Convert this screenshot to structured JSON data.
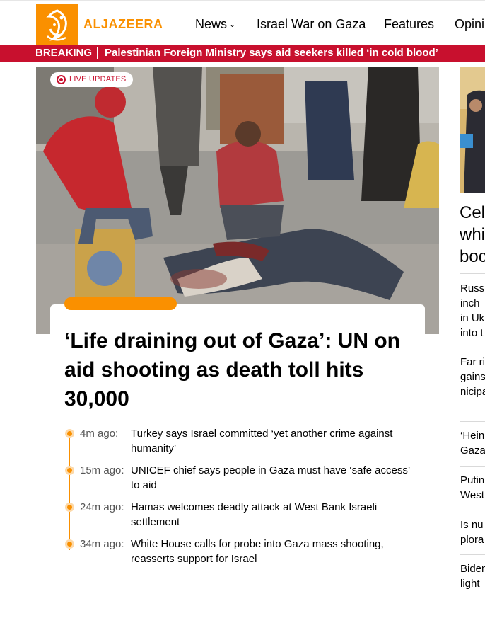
{
  "header": {
    "brand": "ALJAZEERA",
    "nav": [
      {
        "label": "News",
        "has_dropdown": true
      },
      {
        "label": "Israel War on Gaza"
      },
      {
        "label": "Features"
      },
      {
        "label": "Opini"
      }
    ],
    "icons": {
      "logo": "al-jazeera-logo-icon",
      "dropdown": "chevron-down-icon"
    }
  },
  "breaking": {
    "label": "BREAKING",
    "text": "Palestinian Foreign Ministry says aid seekers killed ‘in cold blood’"
  },
  "hero": {
    "badge": "LIVE UPDATES",
    "headline_lines": [
      "‘Life draining out of Gaza’: UN on",
      "aid shooting as death toll hits",
      "30,000"
    ]
  },
  "timeline": [
    {
      "time": "4m ago:",
      "text": "Turkey says Israel committed ‘yet another crime against humanity’"
    },
    {
      "time": "15m ago:",
      "text": "UNICEF chief says people in Gaza must have ‘safe access’ to aid"
    },
    {
      "time": "24m ago:",
      "text": "Hamas welcomes deadly attack at West Bank Israeli settlement"
    },
    {
      "time": "34m ago:",
      "text": "White House calls for probe into Gaza mass shooting, reasserts support for Israel"
    }
  ],
  "sidebar": {
    "big_lines": [
      "Cel",
      "whi",
      "boc"
    ],
    "items": [
      {
        "lines": [
          "Russ",
          "inch",
          "in Uk",
          "into t"
        ]
      },
      {
        "lines": [
          "Far ri",
          "gains",
          "nicipa"
        ]
      },
      {
        "lines": [
          "‘Hein",
          "Gaza"
        ]
      },
      {
        "lines": [
          "Putin",
          "West"
        ]
      },
      {
        "lines": [
          "Is nu",
          "plora"
        ]
      },
      {
        "lines": [
          "Biden",
          "light"
        ]
      }
    ]
  },
  "colors": {
    "brand_orange": "#fa9000",
    "breaking_red": "#c8102e"
  }
}
